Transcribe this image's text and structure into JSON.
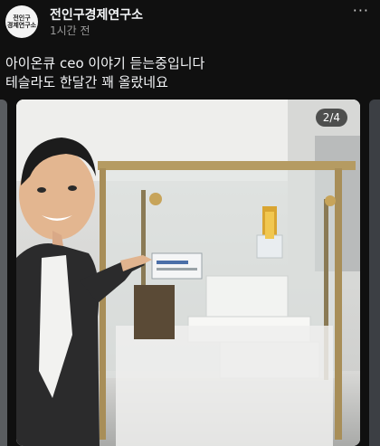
{
  "post": {
    "avatar_line1": "전인구",
    "avatar_line2": "경제연구소",
    "author": "전인구경제연구소",
    "time": "1시간 전",
    "more": "···",
    "lines": [
      "아이온큐 ceo 이야기 듣는중입니다",
      "테슬라도 한달간 꽤 올랐네요"
    ]
  },
  "carousel": {
    "counter": "2/4",
    "photo_icon": "person-pointing-at-display-case-photo"
  }
}
